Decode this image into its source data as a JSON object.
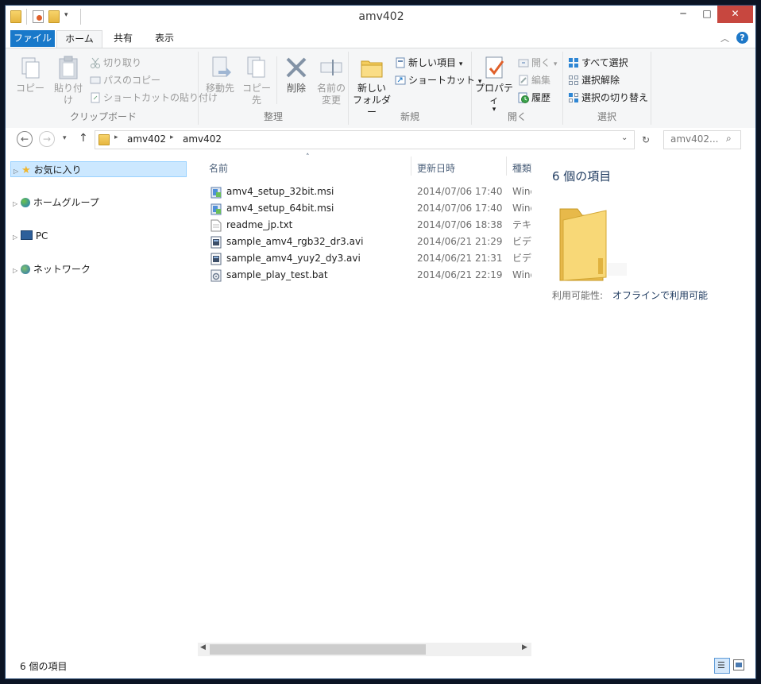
{
  "window": {
    "title": "amv402",
    "controls": {
      "minimize": "─",
      "maximize": "□",
      "close": "✕"
    }
  },
  "ribbon_tabs": [
    "ファイル",
    "ホーム",
    "共有",
    "表示"
  ],
  "ribbon": {
    "clipboard": {
      "label": "クリップボード",
      "copy": "コピー",
      "paste": "貼り付け",
      "cut": "切り取り",
      "copy_path": "パスのコピー",
      "paste_shortcut": "ショートカットの貼り付け"
    },
    "organize": {
      "label": "整理",
      "move_to": "移動先",
      "copy_to": "コピー先",
      "delete": "削除",
      "rename_line1": "名前の",
      "rename_line2": "変更"
    },
    "new": {
      "label": "新規",
      "new_folder_line1": "新しい",
      "new_folder_line2": "フォルダー",
      "new_item": "新しい項目",
      "shortcut": "ショートカット"
    },
    "open": {
      "label": "開く",
      "properties": "プロパティ",
      "open": "開く",
      "edit": "編集",
      "history": "履歴"
    },
    "select": {
      "label": "選択",
      "select_all": "すべて選択",
      "select_none": "選択解除",
      "invert": "選択の切り替え"
    }
  },
  "address": {
    "breadcrumb": [
      "amv402",
      "amv402"
    ],
    "search_placeholder": "amv402..."
  },
  "nav_pane": [
    {
      "label": "お気に入り",
      "icon": "star-icon",
      "selected": true
    },
    {
      "label": "ホームグループ",
      "icon": "homegroup-icon",
      "selected": false
    },
    {
      "label": "PC",
      "icon": "pc-icon",
      "selected": false
    },
    {
      "label": "ネットワーク",
      "icon": "network-icon",
      "selected": false
    }
  ],
  "columns": {
    "name": "名前",
    "date": "更新日時",
    "type": "種類"
  },
  "files": [
    {
      "name": "amv4_setup_32bit.msi",
      "date": "2014/07/06 17:40",
      "type": "Wind",
      "icon": "installer-icon"
    },
    {
      "name": "amv4_setup_64bit.msi",
      "date": "2014/07/06 17:40",
      "type": "Wind",
      "icon": "installer-icon"
    },
    {
      "name": "readme_jp.txt",
      "date": "2014/07/06 18:38",
      "type": "テキス",
      "icon": "text-file-icon"
    },
    {
      "name": "sample_amv4_rgb32_dr3.avi",
      "date": "2014/06/21 21:29",
      "type": "ビデオ",
      "icon": "video-file-icon"
    },
    {
      "name": "sample_amv4_yuy2_dy3.avi",
      "date": "2014/06/21 21:31",
      "type": "ビデオ",
      "icon": "video-file-icon"
    },
    {
      "name": "sample_play_test.bat",
      "date": "2014/06/21 22:19",
      "type": "Wind",
      "icon": "batch-file-icon"
    }
  ],
  "details_pane": {
    "count": "6 個の項目",
    "availability_label": "利用可能性:",
    "availability_value": "オフラインで利用可能"
  },
  "status_bar": {
    "count": "6 個の項目"
  },
  "colors": {
    "file_tab": "#1979ca",
    "close_button": "#c7473f",
    "selection": "#cce8ff"
  }
}
